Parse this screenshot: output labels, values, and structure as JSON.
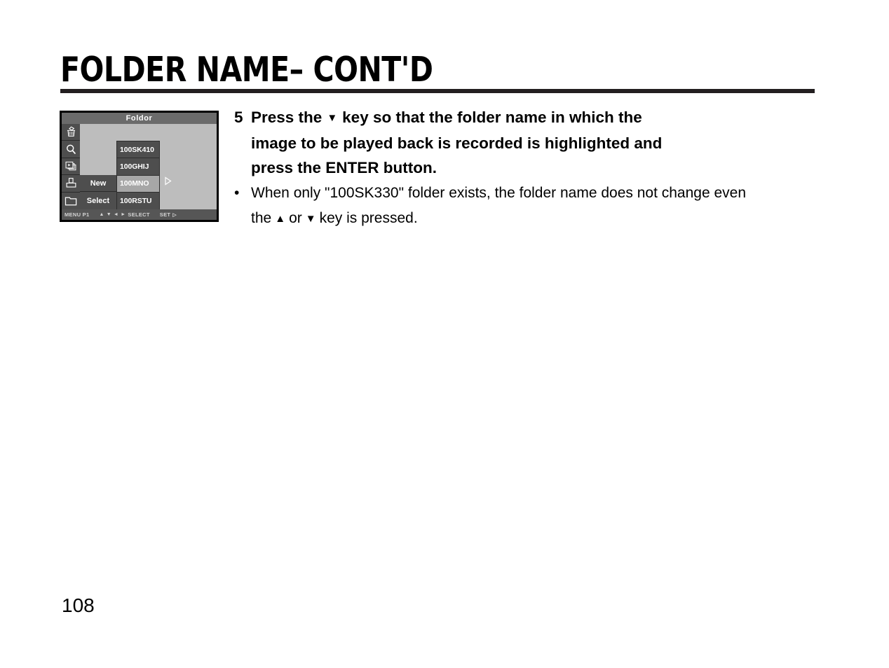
{
  "document": {
    "title": "FOLDER NAME– CONT'D",
    "page_number": "108"
  },
  "lcd": {
    "titlebar": "Foldor",
    "icons": [
      {
        "name": "trash-icon",
        "label": "Delete"
      },
      {
        "name": "search-icon",
        "label": "Search"
      },
      {
        "name": "slideshow-icon",
        "label": "Slideshow"
      },
      {
        "name": "printer-icon",
        "label": "Print"
      },
      {
        "name": "folder-icon",
        "label": "Folder"
      }
    ],
    "actions": [
      {
        "label": "New"
      },
      {
        "label": "Select"
      }
    ],
    "folders": [
      {
        "label": "100SK410",
        "selected": false
      },
      {
        "label": "100GHIJ",
        "selected": false
      },
      {
        "label": "100MNO",
        "selected": true
      },
      {
        "label": "100RSTU",
        "selected": false
      }
    ],
    "status": {
      "menu": "MENU P1",
      "up": "▲",
      "down": "▼",
      "left": "◄",
      "right": "►",
      "select": "SELECT",
      "set": "SET",
      "set_glyph": "▷"
    },
    "colors": {
      "screen_background": "#bdbdbd",
      "titlebar": "#6b6b6b",
      "cell": "#4e4e4e",
      "selected_item": "#a7a7a7",
      "status_bar": "#565656",
      "bezel": "#000000"
    }
  },
  "step": {
    "number": "5",
    "line1_before": "Press the",
    "line1_arrow": "▼",
    "line1_after": "key so that the folder name in which the",
    "line2": "image to be played back is recorded is highlighted and",
    "line3": "press the ENTER button."
  },
  "note": {
    "bullet": "•",
    "line1": "When only \"100SK330\" folder exists, the folder name does not change even",
    "line2_before": "the",
    "line2_up": "▲",
    "line2_mid": "or",
    "line2_down": "▼",
    "line2_after": "key is pressed."
  }
}
